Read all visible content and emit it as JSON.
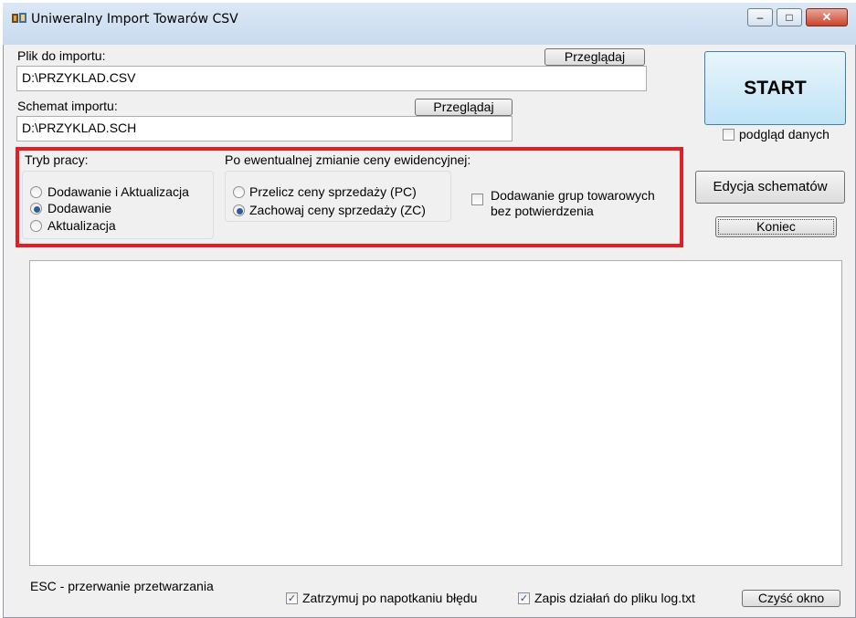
{
  "window": {
    "title": "Uniweralny Import Towarów  CSV",
    "minimize_label": "‒",
    "maximize_label": "□",
    "close_label": "✕"
  },
  "import_file": {
    "label": "Plik do importu:",
    "value": "D:\\PRZYKLAD.CSV",
    "browse_label": "Przeglądaj"
  },
  "schema": {
    "label": "Schemat importu:",
    "value": "D:\\PRZYKLAD.SCH",
    "browse_label": "Przeglądaj"
  },
  "start_label": "START",
  "preview_label": "podgląd danych",
  "preview_checked": false,
  "work_mode": {
    "label": "Tryb pracy:",
    "options": [
      {
        "label": "Dodawanie i Aktualizacja",
        "selected": false
      },
      {
        "label": "Dodawanie",
        "selected": true
      },
      {
        "label": "Aktualizacja",
        "selected": false
      }
    ]
  },
  "price_change": {
    "label": "Po ewentualnej zmianie ceny ewidencyjnej:",
    "options": [
      {
        "label": "Przelicz ceny sprzedaży   (PC)",
        "selected": false
      },
      {
        "label": "Zachowaj ceny sprzedaży (ZC)",
        "selected": true
      }
    ]
  },
  "groups_option": {
    "line1": "Dodawanie grup towarowych",
    "line2": "bez potwierdzenia",
    "checked": false
  },
  "edit_schemas_label": "Edycja schematów",
  "exit_label": "Koniec",
  "footer": {
    "esc_hint": "ESC - przerwanie przetwarzania",
    "stop_on_error_label": "Zatrzymuj po napotkaniu błędu",
    "stop_on_error_checked": true,
    "log_label": "Zapis działań do pliku log.txt",
    "log_checked": true,
    "clear_label": "Czyść okno",
    "check_mark": "✓"
  },
  "colors": {
    "highlight_border": "#e21d23",
    "start_button": "#bfe3f6",
    "window_bg": "#f0f0f0"
  }
}
